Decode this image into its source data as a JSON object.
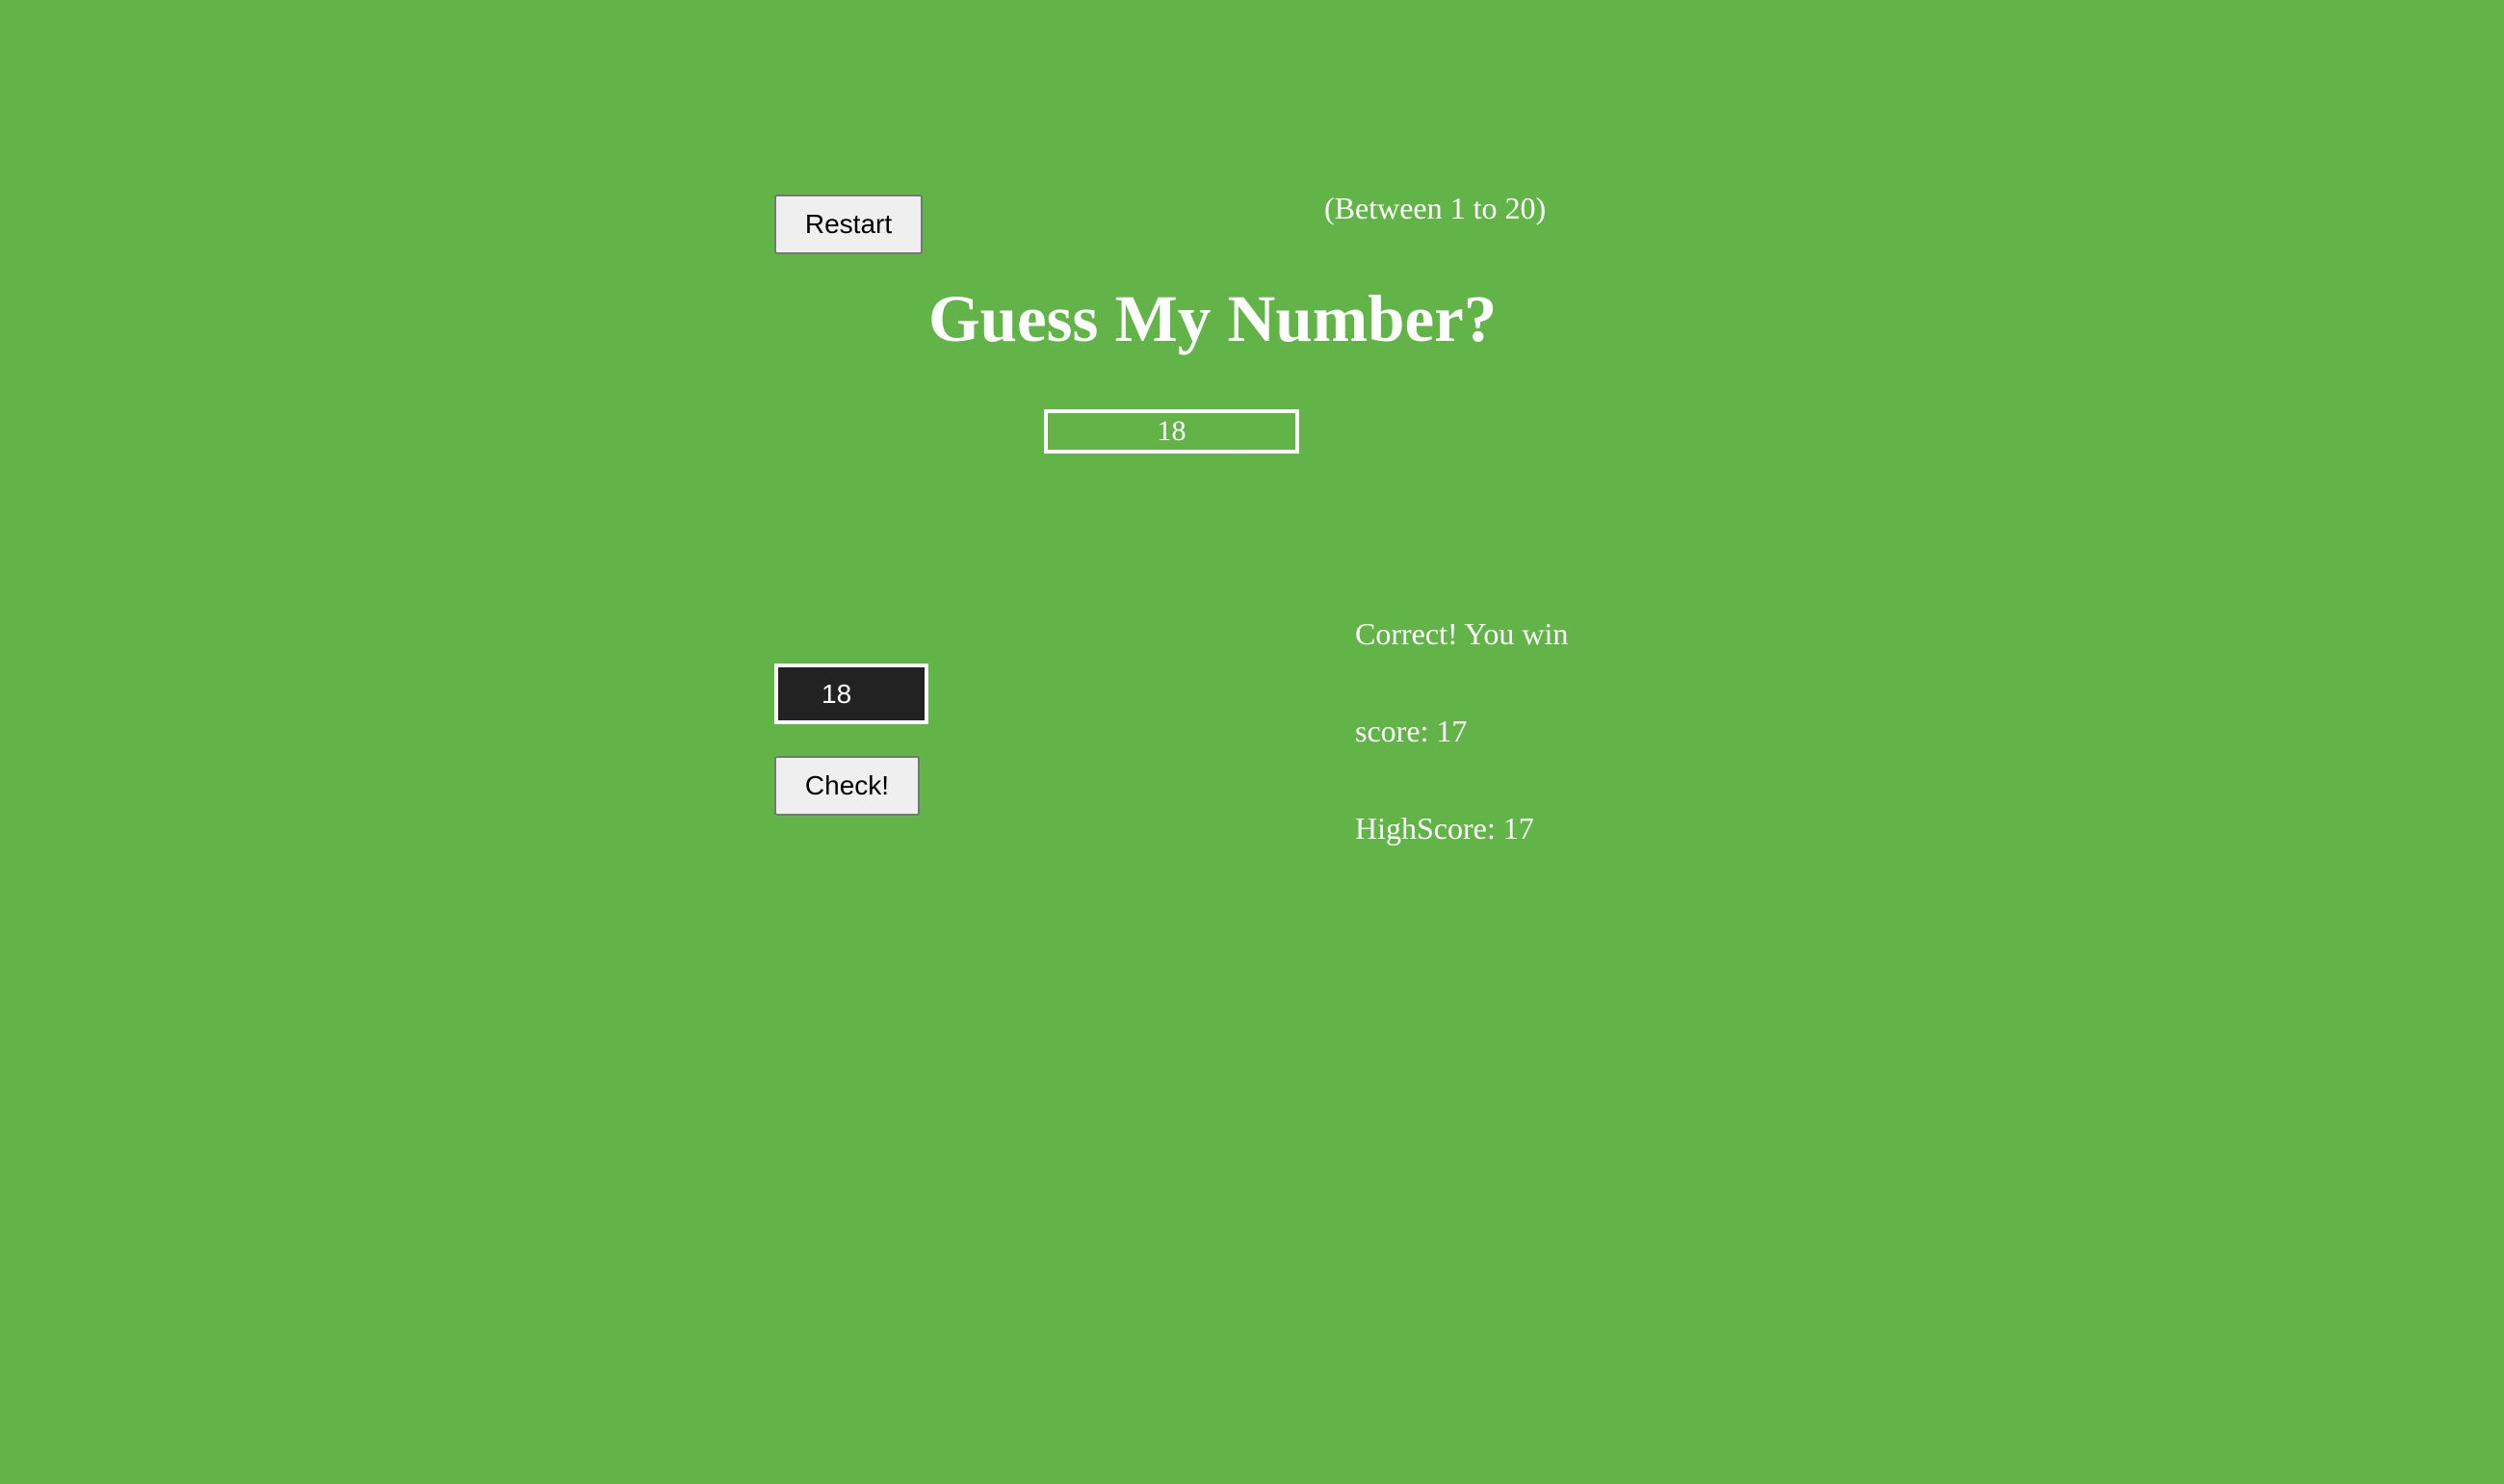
{
  "header": {
    "restart_label": "Restart",
    "range_hint": "(Between 1 to 20)",
    "title": "Guess My Number?"
  },
  "secret_number": "18",
  "guess": {
    "value": "18"
  },
  "check_label": "Check!",
  "status": {
    "message": "Correct! You win",
    "score": "score: 17",
    "highscore": "HighScore: 17"
  },
  "colors": {
    "background": "#62b449",
    "text": "#ffffff",
    "input_background": "#222222"
  }
}
